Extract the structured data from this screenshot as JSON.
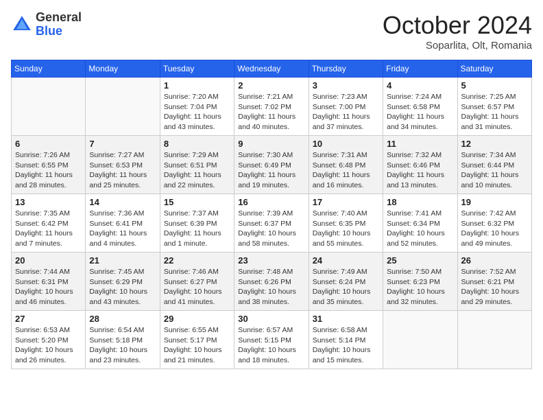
{
  "logo": {
    "general": "General",
    "blue": "Blue"
  },
  "title": "October 2024",
  "location": "Soparlita, Olt, Romania",
  "days_of_week": [
    "Sunday",
    "Monday",
    "Tuesday",
    "Wednesday",
    "Thursday",
    "Friday",
    "Saturday"
  ],
  "weeks": [
    [
      {
        "day": null
      },
      {
        "day": null
      },
      {
        "day": "1",
        "sunrise": "Sunrise: 7:20 AM",
        "sunset": "Sunset: 7:04 PM",
        "daylight": "Daylight: 11 hours and 43 minutes."
      },
      {
        "day": "2",
        "sunrise": "Sunrise: 7:21 AM",
        "sunset": "Sunset: 7:02 PM",
        "daylight": "Daylight: 11 hours and 40 minutes."
      },
      {
        "day": "3",
        "sunrise": "Sunrise: 7:23 AM",
        "sunset": "Sunset: 7:00 PM",
        "daylight": "Daylight: 11 hours and 37 minutes."
      },
      {
        "day": "4",
        "sunrise": "Sunrise: 7:24 AM",
        "sunset": "Sunset: 6:58 PM",
        "daylight": "Daylight: 11 hours and 34 minutes."
      },
      {
        "day": "5",
        "sunrise": "Sunrise: 7:25 AM",
        "sunset": "Sunset: 6:57 PM",
        "daylight": "Daylight: 11 hours and 31 minutes."
      }
    ],
    [
      {
        "day": "6",
        "sunrise": "Sunrise: 7:26 AM",
        "sunset": "Sunset: 6:55 PM",
        "daylight": "Daylight: 11 hours and 28 minutes."
      },
      {
        "day": "7",
        "sunrise": "Sunrise: 7:27 AM",
        "sunset": "Sunset: 6:53 PM",
        "daylight": "Daylight: 11 hours and 25 minutes."
      },
      {
        "day": "8",
        "sunrise": "Sunrise: 7:29 AM",
        "sunset": "Sunset: 6:51 PM",
        "daylight": "Daylight: 11 hours and 22 minutes."
      },
      {
        "day": "9",
        "sunrise": "Sunrise: 7:30 AM",
        "sunset": "Sunset: 6:49 PM",
        "daylight": "Daylight: 11 hours and 19 minutes."
      },
      {
        "day": "10",
        "sunrise": "Sunrise: 7:31 AM",
        "sunset": "Sunset: 6:48 PM",
        "daylight": "Daylight: 11 hours and 16 minutes."
      },
      {
        "day": "11",
        "sunrise": "Sunrise: 7:32 AM",
        "sunset": "Sunset: 6:46 PM",
        "daylight": "Daylight: 11 hours and 13 minutes."
      },
      {
        "day": "12",
        "sunrise": "Sunrise: 7:34 AM",
        "sunset": "Sunset: 6:44 PM",
        "daylight": "Daylight: 11 hours and 10 minutes."
      }
    ],
    [
      {
        "day": "13",
        "sunrise": "Sunrise: 7:35 AM",
        "sunset": "Sunset: 6:42 PM",
        "daylight": "Daylight: 11 hours and 7 minutes."
      },
      {
        "day": "14",
        "sunrise": "Sunrise: 7:36 AM",
        "sunset": "Sunset: 6:41 PM",
        "daylight": "Daylight: 11 hours and 4 minutes."
      },
      {
        "day": "15",
        "sunrise": "Sunrise: 7:37 AM",
        "sunset": "Sunset: 6:39 PM",
        "daylight": "Daylight: 11 hours and 1 minute."
      },
      {
        "day": "16",
        "sunrise": "Sunrise: 7:39 AM",
        "sunset": "Sunset: 6:37 PM",
        "daylight": "Daylight: 10 hours and 58 minutes."
      },
      {
        "day": "17",
        "sunrise": "Sunrise: 7:40 AM",
        "sunset": "Sunset: 6:35 PM",
        "daylight": "Daylight: 10 hours and 55 minutes."
      },
      {
        "day": "18",
        "sunrise": "Sunrise: 7:41 AM",
        "sunset": "Sunset: 6:34 PM",
        "daylight": "Daylight: 10 hours and 52 minutes."
      },
      {
        "day": "19",
        "sunrise": "Sunrise: 7:42 AM",
        "sunset": "Sunset: 6:32 PM",
        "daylight": "Daylight: 10 hours and 49 minutes."
      }
    ],
    [
      {
        "day": "20",
        "sunrise": "Sunrise: 7:44 AM",
        "sunset": "Sunset: 6:31 PM",
        "daylight": "Daylight: 10 hours and 46 minutes."
      },
      {
        "day": "21",
        "sunrise": "Sunrise: 7:45 AM",
        "sunset": "Sunset: 6:29 PM",
        "daylight": "Daylight: 10 hours and 43 minutes."
      },
      {
        "day": "22",
        "sunrise": "Sunrise: 7:46 AM",
        "sunset": "Sunset: 6:27 PM",
        "daylight": "Daylight: 10 hours and 41 minutes."
      },
      {
        "day": "23",
        "sunrise": "Sunrise: 7:48 AM",
        "sunset": "Sunset: 6:26 PM",
        "daylight": "Daylight: 10 hours and 38 minutes."
      },
      {
        "day": "24",
        "sunrise": "Sunrise: 7:49 AM",
        "sunset": "Sunset: 6:24 PM",
        "daylight": "Daylight: 10 hours and 35 minutes."
      },
      {
        "day": "25",
        "sunrise": "Sunrise: 7:50 AM",
        "sunset": "Sunset: 6:23 PM",
        "daylight": "Daylight: 10 hours and 32 minutes."
      },
      {
        "day": "26",
        "sunrise": "Sunrise: 7:52 AM",
        "sunset": "Sunset: 6:21 PM",
        "daylight": "Daylight: 10 hours and 29 minutes."
      }
    ],
    [
      {
        "day": "27",
        "sunrise": "Sunrise: 6:53 AM",
        "sunset": "Sunset: 5:20 PM",
        "daylight": "Daylight: 10 hours and 26 minutes."
      },
      {
        "day": "28",
        "sunrise": "Sunrise: 6:54 AM",
        "sunset": "Sunset: 5:18 PM",
        "daylight": "Daylight: 10 hours and 23 minutes."
      },
      {
        "day": "29",
        "sunrise": "Sunrise: 6:55 AM",
        "sunset": "Sunset: 5:17 PM",
        "daylight": "Daylight: 10 hours and 21 minutes."
      },
      {
        "day": "30",
        "sunrise": "Sunrise: 6:57 AM",
        "sunset": "Sunset: 5:15 PM",
        "daylight": "Daylight: 10 hours and 18 minutes."
      },
      {
        "day": "31",
        "sunrise": "Sunrise: 6:58 AM",
        "sunset": "Sunset: 5:14 PM",
        "daylight": "Daylight: 10 hours and 15 minutes."
      },
      {
        "day": null
      },
      {
        "day": null
      }
    ]
  ]
}
